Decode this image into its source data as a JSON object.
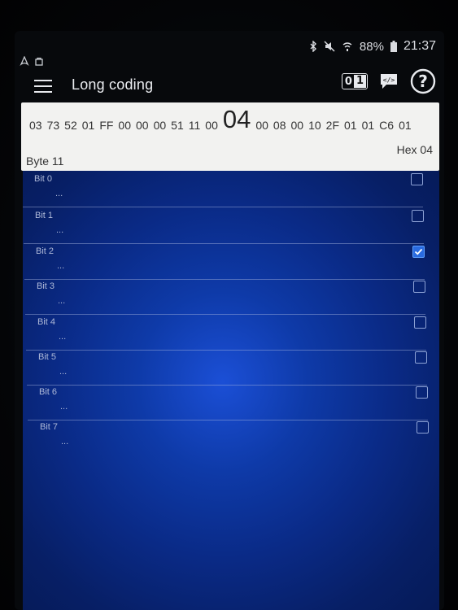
{
  "status": {
    "battery": "88%",
    "time": "21:37"
  },
  "app": {
    "title": "Long coding"
  },
  "hex": {
    "before": [
      "03",
      "73",
      "52",
      "01",
      "FF",
      "00",
      "00",
      "00",
      "51",
      "11",
      "00"
    ],
    "selected": "04",
    "after": [
      "00",
      "08",
      "00",
      "10",
      "2F",
      "01",
      "01",
      "C6",
      "01"
    ],
    "byte_label": "Byte 11",
    "hex_label": "Hex 04"
  },
  "bits": [
    {
      "label": "Bit 0",
      "desc": "...",
      "checked": false
    },
    {
      "label": "Bit 1",
      "desc": "...",
      "checked": false
    },
    {
      "label": "Bit 2",
      "desc": "...",
      "checked": true
    },
    {
      "label": "Bit 3",
      "desc": "...",
      "checked": false
    },
    {
      "label": "Bit 4",
      "desc": "...",
      "checked": false
    },
    {
      "label": "Bit 5",
      "desc": "...",
      "checked": false
    },
    {
      "label": "Bit 6",
      "desc": "...",
      "checked": false
    },
    {
      "label": "Bit 7",
      "desc": "...",
      "checked": false
    }
  ]
}
